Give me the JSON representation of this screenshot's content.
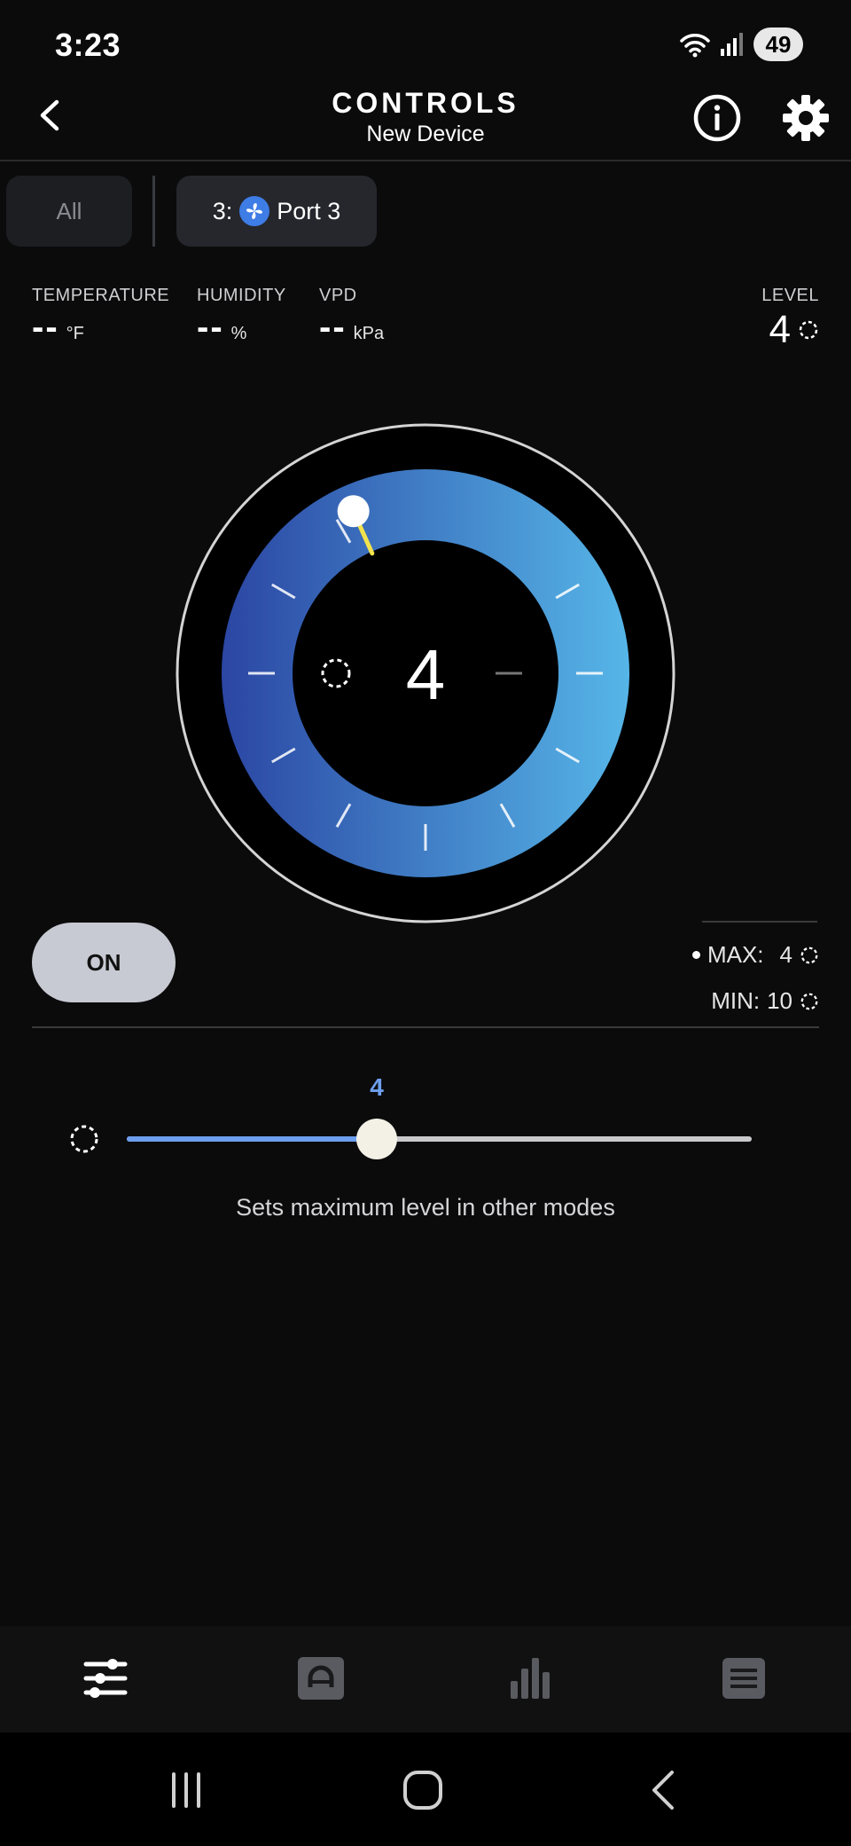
{
  "status_bar": {
    "time": "3:23",
    "battery": "49"
  },
  "header": {
    "title": "CONTROLS",
    "subtitle": "New Device"
  },
  "tabs": {
    "all_label": "All",
    "port_prefix": "3:",
    "port_label": "Port 3"
  },
  "readings": {
    "temperature": {
      "label": "TEMPERATURE",
      "value": "--",
      "unit": "°F"
    },
    "humidity": {
      "label": "HUMIDITY",
      "value": "--",
      "unit": "%"
    },
    "vpd": {
      "label": "VPD",
      "value": "--",
      "unit": "kPa"
    },
    "level": {
      "label": "LEVEL",
      "value": "4"
    }
  },
  "dial": {
    "level_value": "4",
    "level": 4,
    "max_level": 10
  },
  "power": {
    "label": "ON"
  },
  "limits": {
    "max_label": "MAX:",
    "max_value": "4",
    "min_label": "MIN:",
    "min_value": "10"
  },
  "slider": {
    "value_label": "4",
    "value": 4,
    "min": 0,
    "max": 10,
    "caption": "Sets maximum level in other modes"
  },
  "nav": {
    "items": [
      "sliders-icon",
      "auto-mode-icon",
      "chart-bars-icon",
      "list-icon"
    ]
  },
  "colors": {
    "accent": "#6d9fee",
    "gradient_start": "#2b46a3",
    "gradient_end": "#56b6e8",
    "needle": "#f2e24c",
    "fan_badge": "#3e7ce6"
  }
}
